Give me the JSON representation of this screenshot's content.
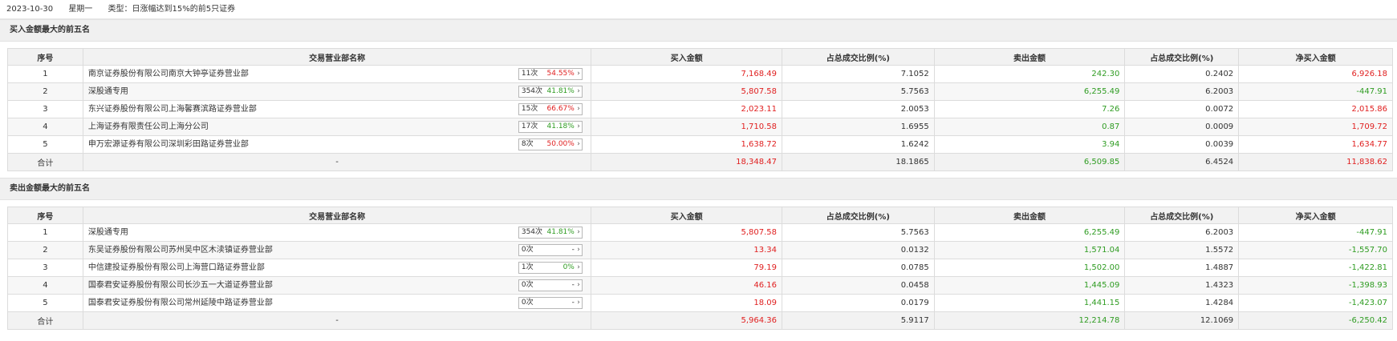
{
  "header": {
    "date": "2023-10-30",
    "weekday": "星期一",
    "type_label": "类型：日涨幅达到15%的前5只证券"
  },
  "columns": [
    "序号",
    "交易营业部名称",
    "买入金额",
    "占总成交比例(%)",
    "卖出金额",
    "占总成交比例(%)",
    "净买入金额"
  ],
  "buy_section": {
    "title": "买入金额最大的前五名",
    "rows": [
      {
        "no": "1",
        "name": "南京证券股份有限公司南京大钟亭证券营业部",
        "count": "11次",
        "pct": "54.55%",
        "arrow": "›",
        "buy": "7,168.49",
        "buy_ratio": "7.1052",
        "sell": "242.30",
        "sell_ratio": "0.2402",
        "net": "6,926.18"
      },
      {
        "no": "2",
        "name": "深股通专用",
        "count": "354次",
        "pct": "41.81%",
        "arrow": "›",
        "buy": "5,807.58",
        "buy_ratio": "5.7563",
        "sell": "6,255.49",
        "sell_ratio": "6.2003",
        "net": "-447.91"
      },
      {
        "no": "3",
        "name": "东兴证券股份有限公司上海馨赛滨路证券营业部",
        "count": "15次",
        "pct": "66.67%",
        "arrow": "›",
        "buy": "2,023.11",
        "buy_ratio": "2.0053",
        "sell": "7.26",
        "sell_ratio": "0.0072",
        "net": "2,015.86"
      },
      {
        "no": "4",
        "name": "上海证券有限责任公司上海分公司",
        "count": "17次",
        "pct": "41.18%",
        "arrow": "›",
        "buy": "1,710.58",
        "buy_ratio": "1.6955",
        "sell": "0.87",
        "sell_ratio": "0.0009",
        "net": "1,709.72"
      },
      {
        "no": "5",
        "name": "申万宏源证券有限公司深圳彩田路证券营业部",
        "count": "8次",
        "pct": "50.00%",
        "arrow": "›",
        "buy": "1,638.72",
        "buy_ratio": "1.6242",
        "sell": "3.94",
        "sell_ratio": "0.0039",
        "net": "1,634.77"
      }
    ],
    "total": {
      "label": "合计",
      "dash": "-",
      "buy": "18,348.47",
      "buy_ratio": "18.1865",
      "sell": "6,509.85",
      "sell_ratio": "6.4524",
      "net": "11,838.62"
    }
  },
  "sell_section": {
    "title": "卖出金额最大的前五名",
    "rows": [
      {
        "no": "1",
        "name": "深股通专用",
        "count": "354次",
        "pct": "41.81%",
        "arrow": "›",
        "buy": "5,807.58",
        "buy_ratio": "5.7563",
        "sell": "6,255.49",
        "sell_ratio": "6.2003",
        "net": "-447.91"
      },
      {
        "no": "2",
        "name": "东吴证券股份有限公司苏州吴中区木渎镇证券营业部",
        "count": "0次",
        "pct": "-",
        "arrow": "›",
        "buy": "13.34",
        "buy_ratio": "0.0132",
        "sell": "1,571.04",
        "sell_ratio": "1.5572",
        "net": "-1,557.70"
      },
      {
        "no": "3",
        "name": "中信建投证券股份有限公司上海营口路证券营业部",
        "count": "1次",
        "pct": "0%",
        "arrow": "›",
        "buy": "79.19",
        "buy_ratio": "0.0785",
        "sell": "1,502.00",
        "sell_ratio": "1.4887",
        "net": "-1,422.81"
      },
      {
        "no": "4",
        "name": "国泰君安证券股份有限公司长沙五一大道证券营业部",
        "count": "0次",
        "pct": "-",
        "arrow": "›",
        "buy": "46.16",
        "buy_ratio": "0.0458",
        "sell": "1,445.09",
        "sell_ratio": "1.4323",
        "net": "-1,398.93"
      },
      {
        "no": "5",
        "name": "国泰君安证券股份有限公司常州延陵中路证券营业部",
        "count": "0次",
        "pct": "-",
        "arrow": "›",
        "buy": "18.09",
        "buy_ratio": "0.0179",
        "sell": "1,441.15",
        "sell_ratio": "1.4284",
        "net": "-1,423.07"
      }
    ],
    "total": {
      "label": "合计",
      "dash": "-",
      "buy": "5,964.36",
      "buy_ratio": "5.9117",
      "sell": "12,214.78",
      "sell_ratio": "12.1069",
      "net": "-6,250.42"
    }
  },
  "colors": {
    "positive": "#e02020",
    "negative": "#2f9c22",
    "header_bg": "#f2f2f2",
    "section_bg": "#f0f0f0"
  }
}
